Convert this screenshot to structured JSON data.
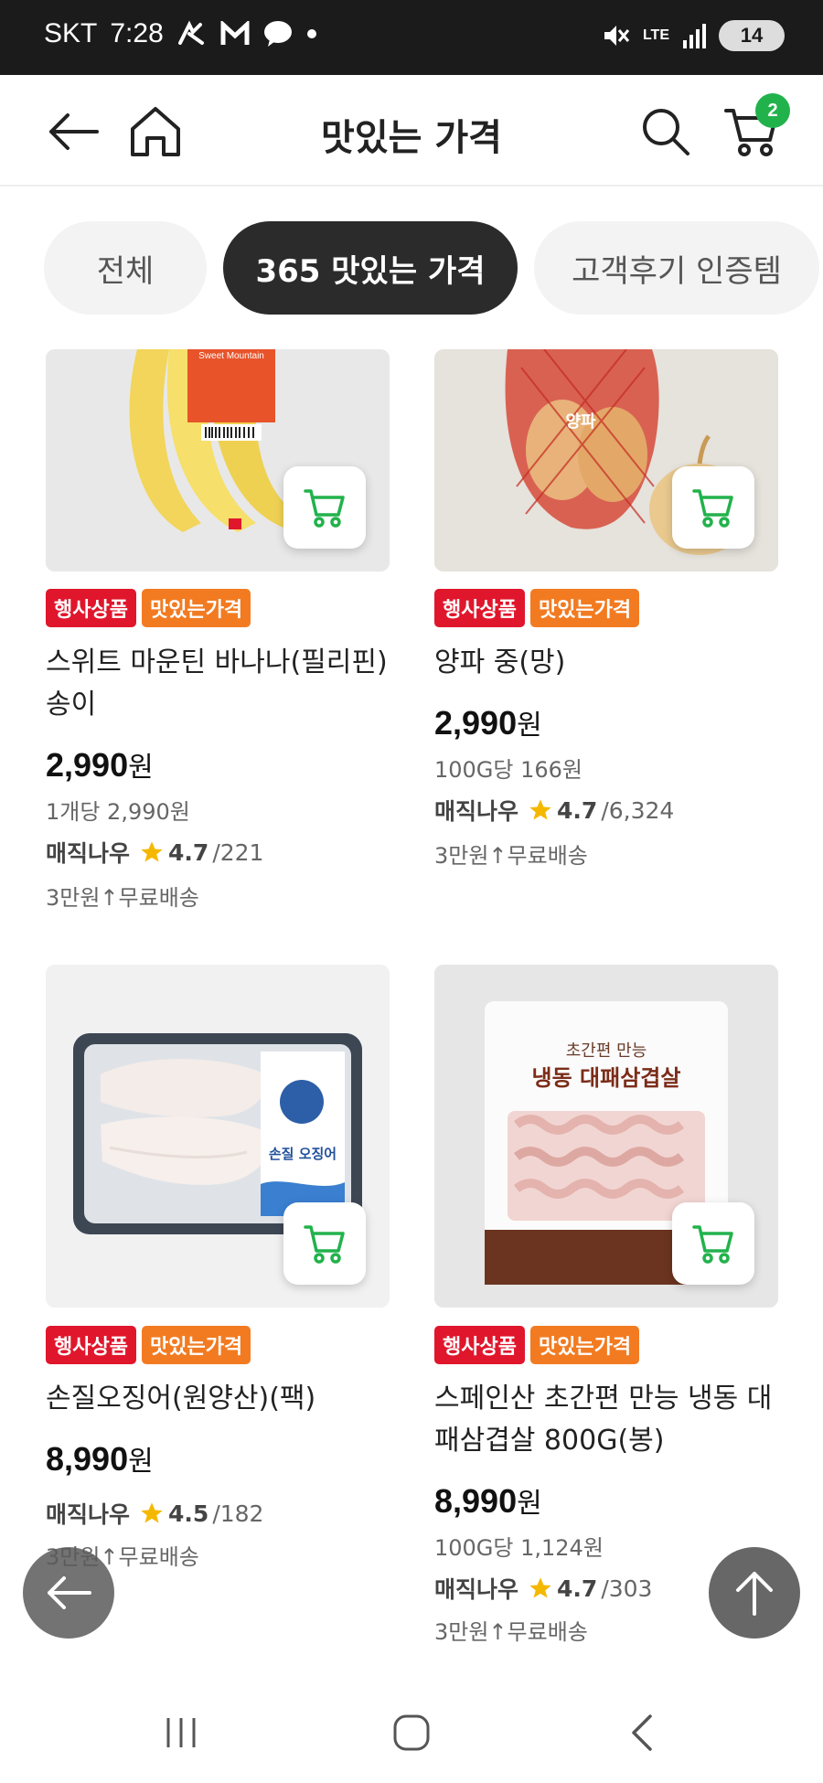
{
  "status_bar": {
    "carrier": "SKT",
    "time": "7:28",
    "network": "LTE",
    "battery": "14"
  },
  "header": {
    "title": "맛있는 가격",
    "cart_count": "2"
  },
  "tabs": [
    {
      "label": "전체",
      "active": false
    },
    {
      "label": "365 맛있는 가격",
      "active": true
    },
    {
      "label": "고객후기 인증템",
      "active": false
    }
  ],
  "products": [
    {
      "tags": [
        "행사상품",
        "맛있는가격"
      ],
      "name": "스위트 마운틴 바나나(필리핀) 송이",
      "price": "2,990",
      "currency": "원",
      "unit_price": "1개당 2,990원",
      "seller": "매직나우",
      "rating": "4.7",
      "reviews": "/221",
      "shipping": "3만원↑무료배송",
      "image_label": "Sweet Mountain"
    },
    {
      "tags": [
        "행사상품",
        "맛있는가격"
      ],
      "name": "양파 중(망)",
      "price": "2,990",
      "currency": "원",
      "unit_price": "100G당 166원",
      "seller": "매직나우",
      "rating": "4.7",
      "reviews": "/6,324",
      "shipping": "3만원↑무료배송",
      "image_label": "양파"
    },
    {
      "tags": [
        "행사상품",
        "맛있는가격"
      ],
      "name": "손질오징어(원양산)(팩)",
      "price": "8,990",
      "currency": "원",
      "seller": "매직나우",
      "rating": "4.5",
      "reviews": "/182",
      "shipping": "3만원↑무료배송",
      "image_label": "손질 오징어"
    },
    {
      "tags": [
        "행사상품",
        "맛있는가격"
      ],
      "name": "스페인산 초간편 만능 냉동 대패삼겹살 800G(봉)",
      "price": "8,990",
      "currency": "원",
      "unit_price": "100G당 1,124원",
      "seller": "매직나우",
      "rating": "4.7",
      "reviews": "/303",
      "shipping": "3만원↑무료배송",
      "image_label_top": "초간편 만능",
      "image_label_main": "냉동 대패삼겹살"
    }
  ],
  "colors": {
    "event_tag": "#e0162c",
    "tasty_tag": "#f27b21",
    "cart_green": "#22b24c",
    "star": "#f5b800"
  }
}
